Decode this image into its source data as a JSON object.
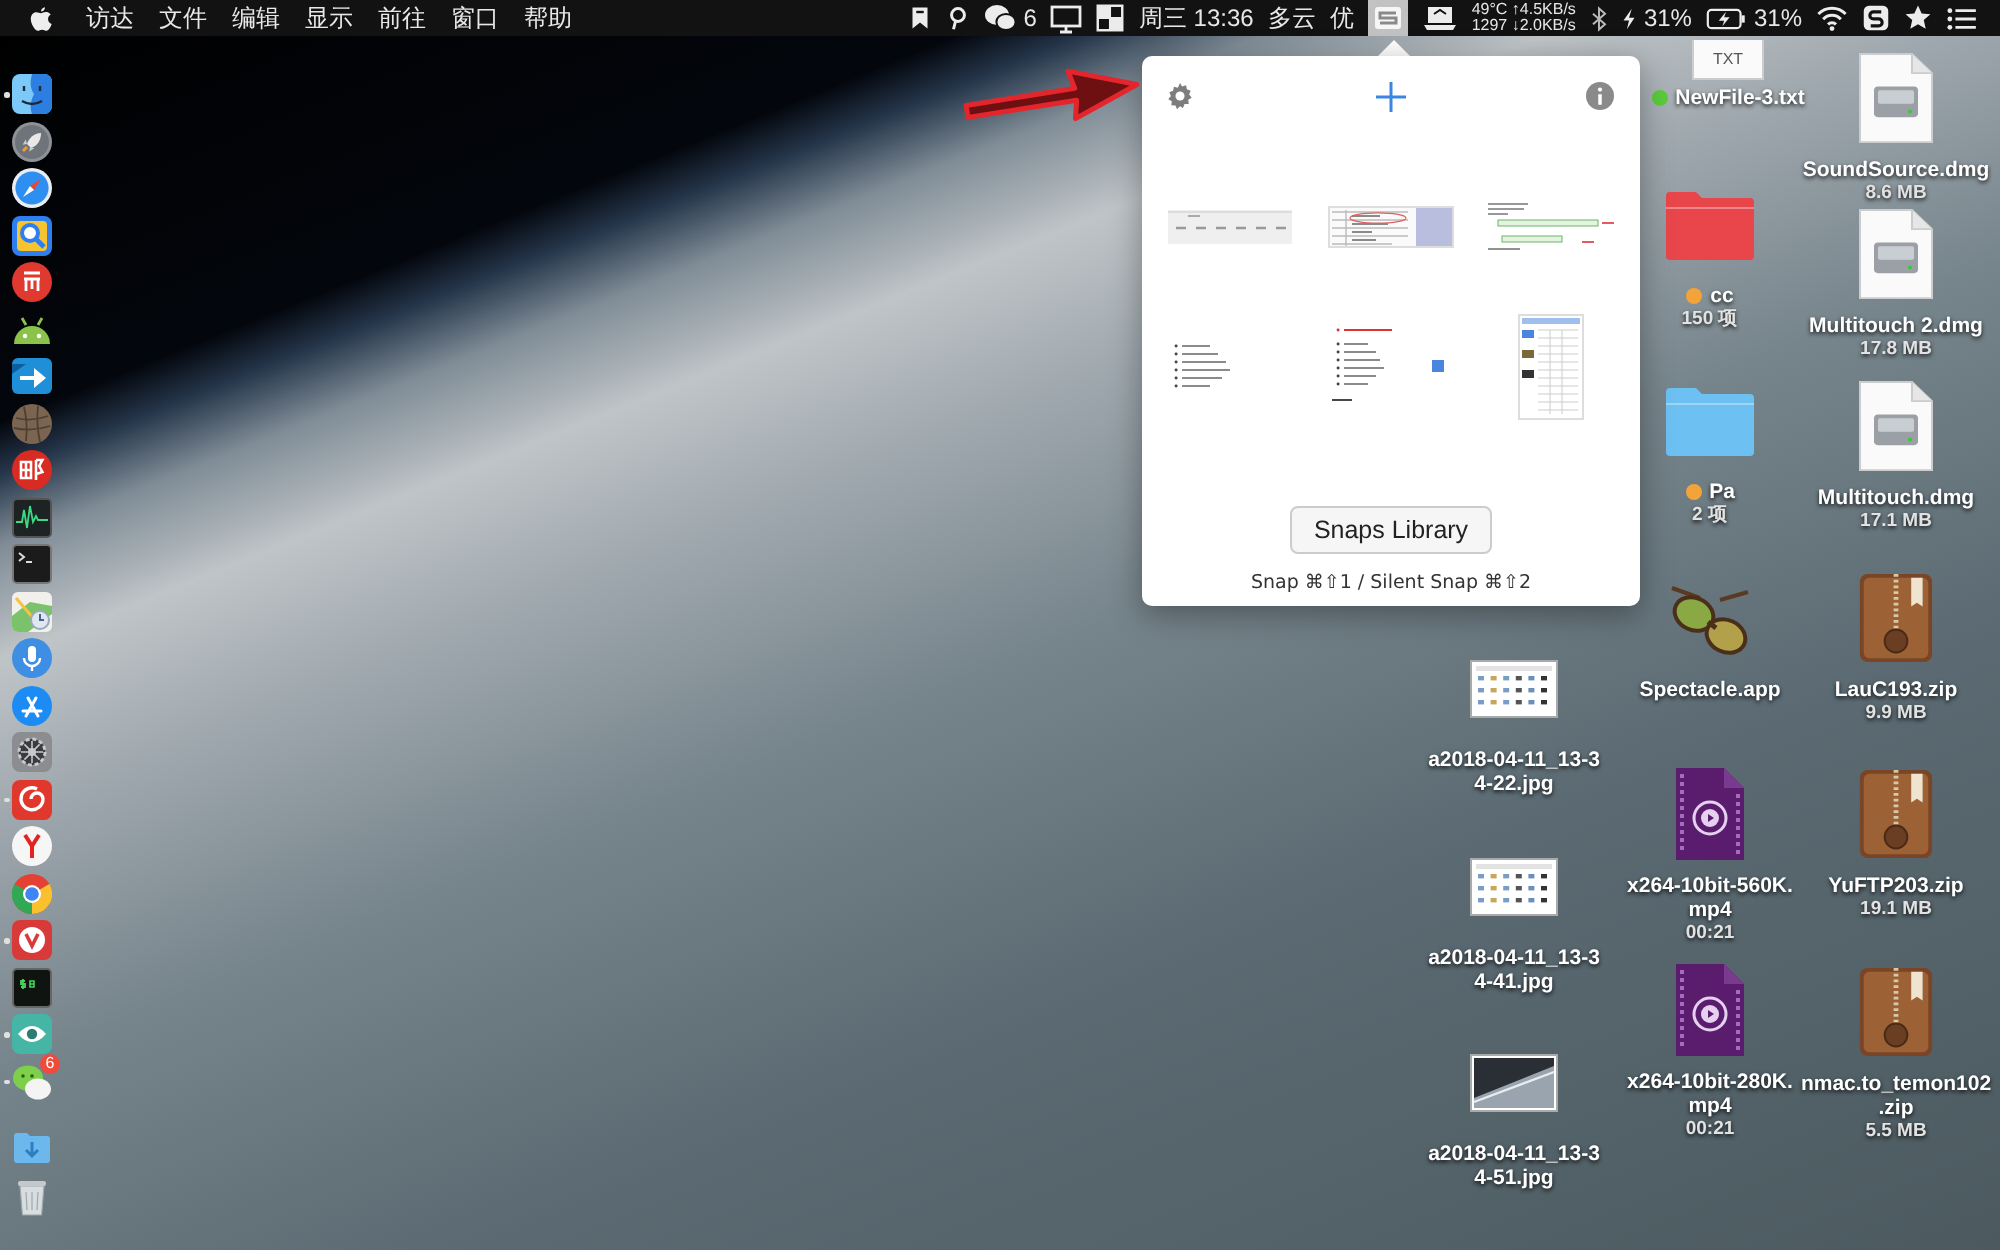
{
  "menu_bar": {
    "menus": [
      "访达",
      "文件",
      "编辑",
      "显示",
      "前往",
      "窗口",
      "帮助"
    ],
    "status_items": [
      {
        "kind": "bookmark",
        "selected": false
      },
      {
        "kind": "pin",
        "selected": false
      },
      {
        "kind": "chat",
        "label": "6",
        "selected": false
      },
      {
        "kind": "display",
        "selected": false
      },
      {
        "kind": "grid",
        "selected": false
      },
      {
        "kind": "text",
        "label": "周三 13:36",
        "selected": false
      },
      {
        "kind": "text",
        "label": "多云",
        "selected": false
      },
      {
        "kind": "text",
        "label": "优",
        "selected": false
      },
      {
        "kind": "snap",
        "selected": true
      },
      {
        "kind": "laptop",
        "selected": false
      },
      {
        "kind": "stats",
        "lines": [
          "49°C ↑4.5KB/s",
          "1297 ↓2.0KB/s"
        ],
        "selected": false
      },
      {
        "kind": "bluetooth",
        "selected": false
      },
      {
        "kind": "bolt",
        "label": "31%",
        "selected": false
      },
      {
        "kind": "battery",
        "label": "31%",
        "selected": false
      },
      {
        "kind": "wifi",
        "selected": false
      },
      {
        "kind": "sogou",
        "selected": false
      },
      {
        "kind": "star",
        "selected": false
      },
      {
        "kind": "list",
        "selected": false
      }
    ]
  },
  "dock": {
    "items": [
      {
        "kind": "finder",
        "running": true
      },
      {
        "kind": "rocket",
        "running": false
      },
      {
        "kind": "compass",
        "running": false
      },
      {
        "kind": "magnifier",
        "running": false
      },
      {
        "kind": "bars",
        "running": false
      },
      {
        "kind": "android",
        "running": false
      },
      {
        "kind": "arrow",
        "running": false
      },
      {
        "kind": "ball",
        "running": false
      },
      {
        "kind": "seal",
        "running": false
      },
      {
        "kind": "waveform",
        "running": false
      },
      {
        "kind": "terminal",
        "running": false
      },
      {
        "kind": "map",
        "running": false
      },
      {
        "kind": "microphone",
        "running": false
      },
      {
        "kind": "store",
        "running": false
      },
      {
        "kind": "settings",
        "running": false
      },
      {
        "kind": "swirl",
        "running": true
      },
      {
        "kind": "yletter",
        "running": false
      },
      {
        "kind": "wheel",
        "running": false
      },
      {
        "kind": "vletter",
        "running": true
      },
      {
        "kind": "shell",
        "running": false
      },
      {
        "kind": "eye",
        "running": true
      },
      {
        "kind": "chat",
        "running": true,
        "badge": "6"
      },
      {
        "kind": "downloads",
        "running": false
      },
      {
        "kind": "trash",
        "running": false
      }
    ]
  },
  "popup": {
    "snaps": [
      {
        "kind": "table"
      },
      {
        "kind": "form"
      },
      {
        "kind": "text"
      },
      {
        "kind": "list"
      },
      {
        "kind": "note"
      },
      {
        "kind": "page"
      }
    ],
    "button": "Snaps Library",
    "hint": "Snap ⌘⇧1 / Silent Snap ⌘⇧2"
  },
  "desktop_icons": [
    {
      "kind": "txt",
      "badge": "TXT",
      "lines": [
        "NewFile-3.txt"
      ],
      "tag": {
        "color": "#5ccc3c"
      }
    },
    {
      "kind": "dmg",
      "lines": [
        "SoundSource.dmg"
      ],
      "info": "8.6 MB"
    },
    {
      "kind": "folder",
      "color": "#e8464a",
      "lines": [
        "cc"
      ],
      "tag": {
        "color": "#f2a33a"
      },
      "info": "150 项"
    },
    {
      "kind": "dmg",
      "lines": [
        "Multitouch 2.dmg"
      ],
      "info": "17.8 MB"
    },
    {
      "kind": "folder",
      "color": "#6cc0f2",
      "lines": [
        "Pa"
      ],
      "tag": {
        "color": "#f2a33a"
      },
      "info": "2 项"
    },
    {
      "kind": "dmg",
      "lines": [
        "Multitouch.dmg"
      ],
      "info": "17.1 MB"
    },
    {
      "kind": "app",
      "lines": [
        "Spectacle.app"
      ]
    },
    {
      "kind": "zip",
      "lines": [
        "LauC193.zip"
      ],
      "info": "9.9 MB"
    },
    {
      "kind": "screenshot",
      "lines": [
        "a2018-04-11_13-3",
        "4-22.jpg"
      ]
    },
    {
      "kind": "video",
      "lines": [
        "x264-10bit-560K.",
        "mp4"
      ],
      "info": "00:21"
    },
    {
      "kind": "zip",
      "lines": [
        "YuFTP203.zip"
      ],
      "info": "19.1 MB"
    },
    {
      "kind": "screenshot",
      "lines": [
        "a2018-04-11_13-3",
        "4-41.jpg"
      ]
    },
    {
      "kind": "video",
      "lines": [
        "x264-10bit-280K.",
        "mp4"
      ],
      "info": "00:21"
    },
    {
      "kind": "zip",
      "lines": [
        "nmac.to_temon102",
        ".zip"
      ],
      "info": "5.5 MB"
    },
    {
      "kind": "photo",
      "lines": [
        "a2018-04-11_13-3",
        "4-51.jpg"
      ]
    }
  ]
}
